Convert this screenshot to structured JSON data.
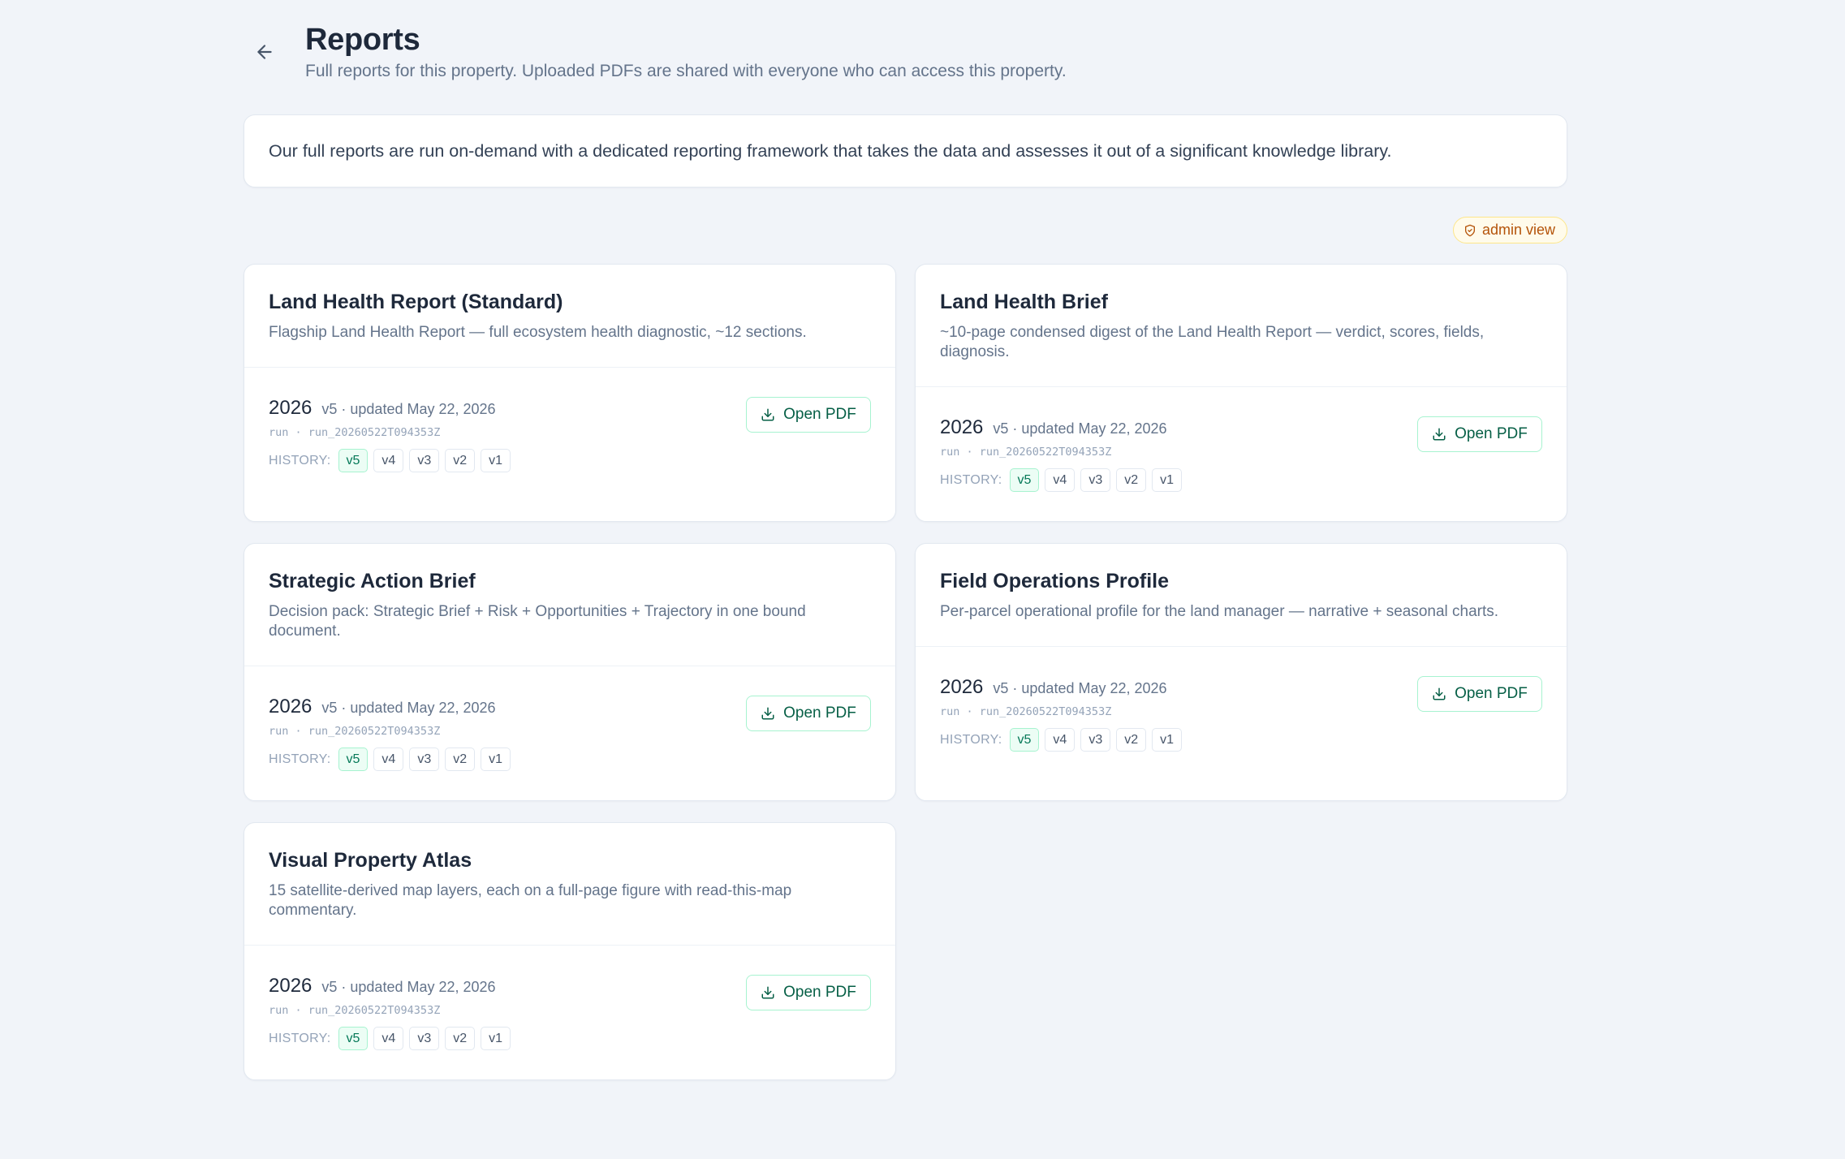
{
  "header": {
    "title": "Reports",
    "subtitle": "Full reports for this property. Uploaded PDFs are shared with everyone who can access this property."
  },
  "intro": {
    "text": "Our full reports are run on-demand with a dedicated reporting framework that takes the data and assesses it out of a significant knowledge library."
  },
  "admin_badge": {
    "label": "admin view",
    "icon": "shield-icon"
  },
  "common": {
    "open_label": "Open PDF",
    "history_label": "HISTORY:",
    "history_versions": [
      "v5",
      "v4",
      "v3",
      "v2",
      "v1"
    ],
    "active_version": "v5"
  },
  "reports": [
    {
      "title": "Land Health Report (Standard)",
      "description": "Flagship Land Health Report — full ecosystem health diagnostic, ~12 sections.",
      "year": "2026",
      "meta": "v5 · updated May 22, 2026",
      "run": "run · run_20260522T094353Z"
    },
    {
      "title": "Land Health Brief",
      "description": "~10-page condensed digest of the Land Health Report — verdict, scores, fields, diagnosis.",
      "year": "2026",
      "meta": "v5 · updated May 22, 2026",
      "run": "run · run_20260522T094353Z"
    },
    {
      "title": "Strategic Action Brief",
      "description": "Decision pack: Strategic Brief + Risk + Opportunities + Trajectory in one bound document.",
      "year": "2026",
      "meta": "v5 · updated May 22, 2026",
      "run": "run · run_20260522T094353Z"
    },
    {
      "title": "Field Operations Profile",
      "description": "Per-parcel operational profile for the land manager — narrative + seasonal charts.",
      "year": "2026",
      "meta": "v5 · updated May 22, 2026",
      "run": "run · run_20260522T094353Z"
    },
    {
      "title": "Visual Property Atlas",
      "description": "15 satellite-derived map layers, each on a full-page figure with read-this-map commentary.",
      "year": "2026",
      "meta": "v5 · updated May 22, 2026",
      "run": "run · run_20260522T094353Z"
    }
  ],
  "colors": {
    "background": "#f1f4f9",
    "accent": "#047857",
    "admin": "#b45309"
  }
}
